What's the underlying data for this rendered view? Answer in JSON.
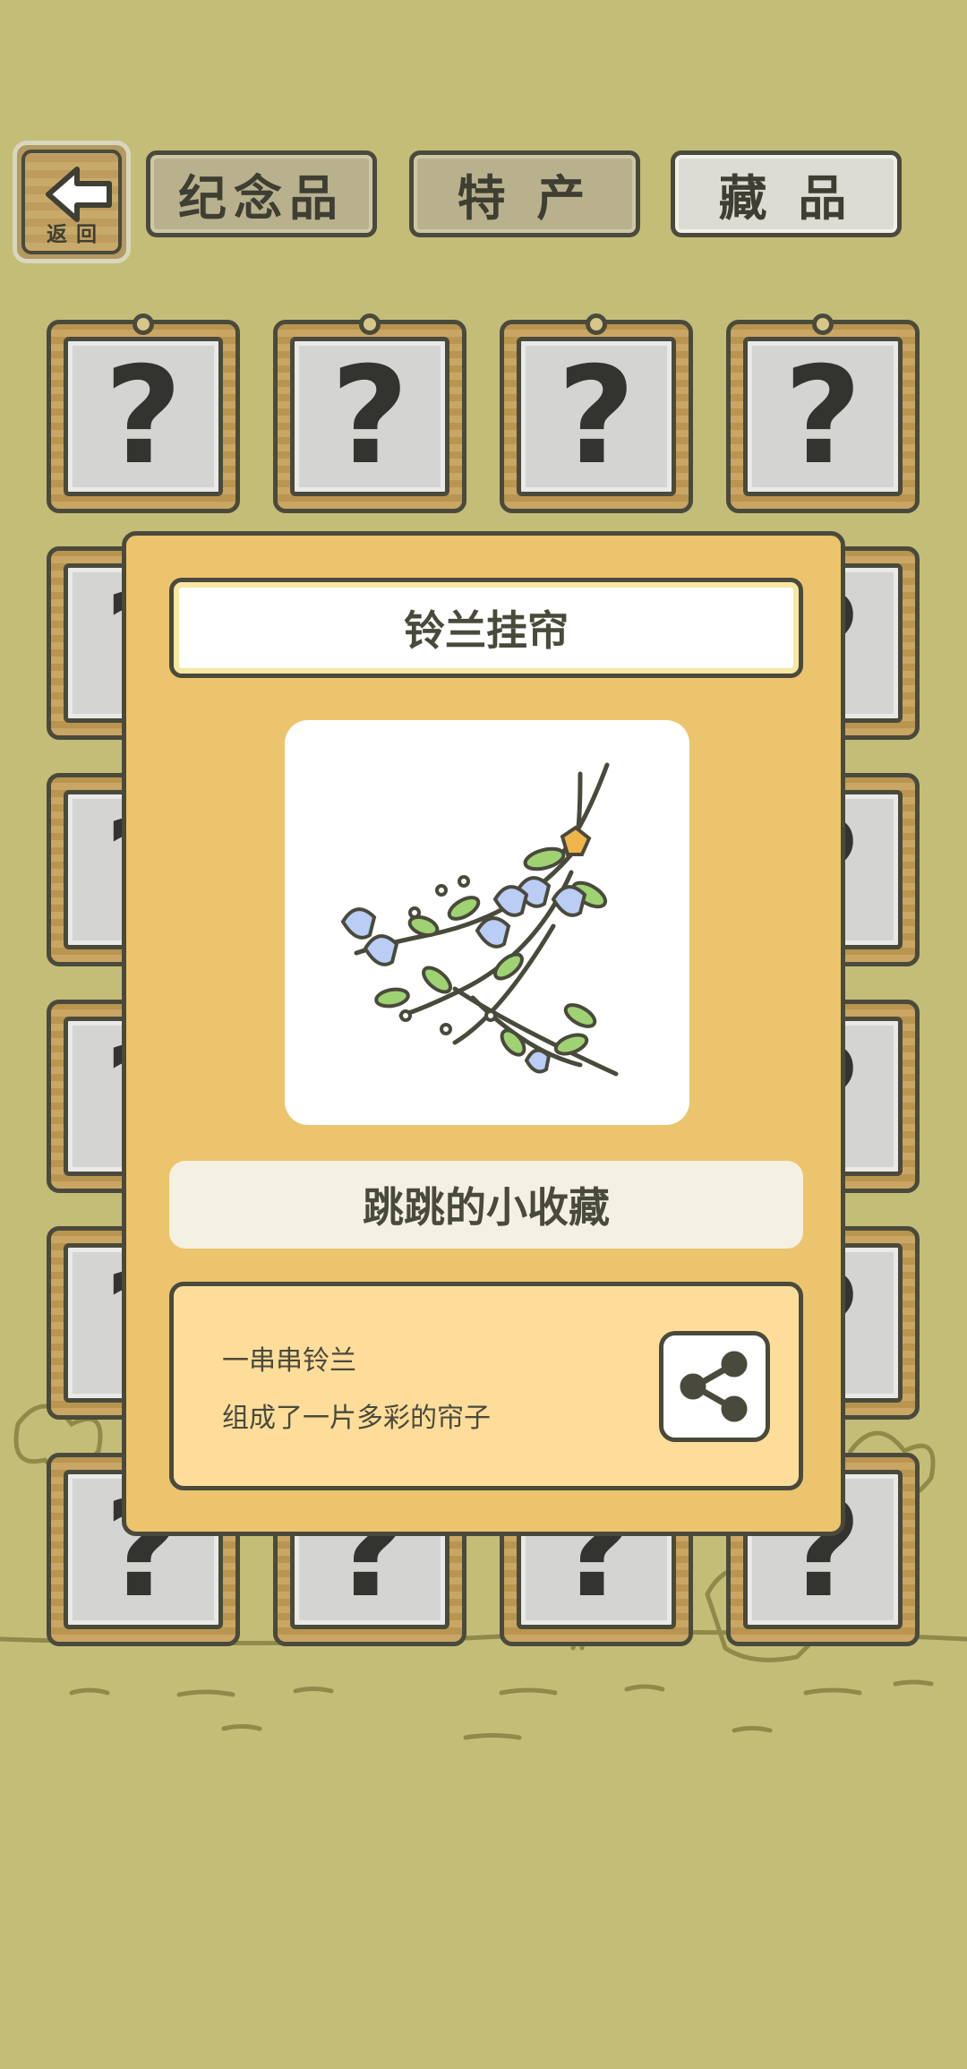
{
  "header": {
    "back_label": "返回",
    "tabs": [
      {
        "label": "纪念品",
        "active": false
      },
      {
        "label": "特 产",
        "active": false
      },
      {
        "label": "藏 品",
        "active": true
      }
    ]
  },
  "grid": {
    "unknown_glyph": "?"
  },
  "modal": {
    "title": "铃兰挂帘",
    "image_icon": "lily-of-the-valley-curtain",
    "category": "跳跳的小收藏",
    "description": [
      "一串串铃兰",
      "组成了一片多彩的帘子"
    ],
    "share_icon": "share-icon"
  },
  "colors": {
    "background": "#c3bd78",
    "modal": "#ecc46d",
    "desc_box": "#fedd9b",
    "outline": "#4a4a3c"
  }
}
